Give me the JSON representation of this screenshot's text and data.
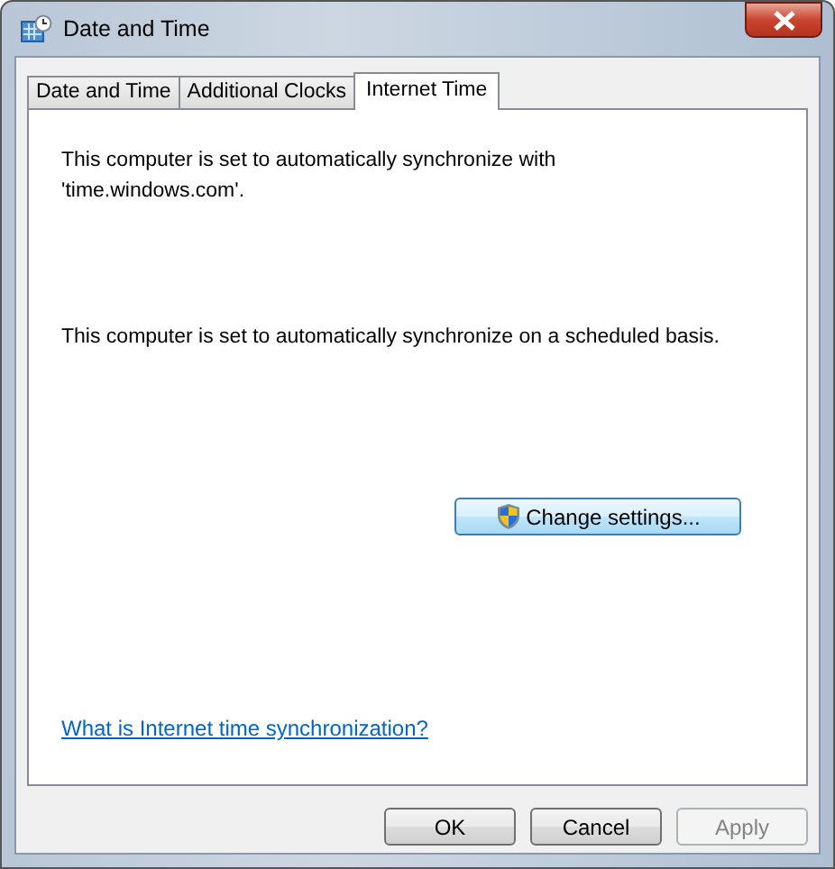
{
  "window": {
    "title": "Date and Time"
  },
  "tabs": [
    {
      "label": "Date and Time",
      "selected": false
    },
    {
      "label": "Additional Clocks",
      "selected": false
    },
    {
      "label": "Internet Time",
      "selected": true
    }
  ],
  "panel": {
    "sync_server_text": "This computer is set to automatically synchronize with 'time.windows.com'.",
    "schedule_text": "This computer is set to automatically synchronize on a scheduled basis.",
    "change_button": "Change settings...",
    "help_link": "What is Internet time synchronization?"
  },
  "buttons": [
    {
      "label": "OK",
      "disabled": false
    },
    {
      "label": "Cancel",
      "disabled": false
    },
    {
      "label": "Apply",
      "disabled": true
    }
  ]
}
